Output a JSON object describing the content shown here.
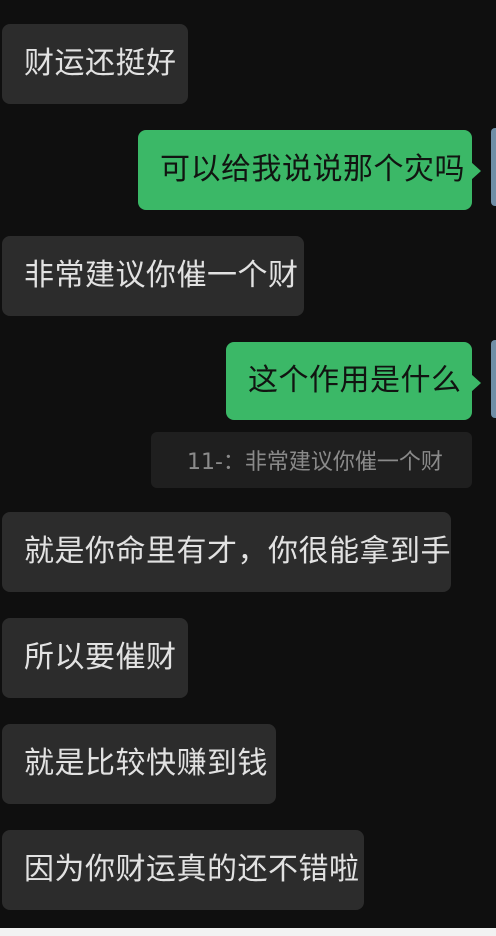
{
  "messages": [
    {
      "side": "in",
      "text": "财运还挺好"
    },
    {
      "side": "out",
      "text": "可以给我说说那个灾吗"
    },
    {
      "side": "in",
      "text": "非常建议你催一个财"
    },
    {
      "side": "out",
      "text": "这个作用是什么"
    },
    {
      "side": "in",
      "text": "就是你命里有才，你很能拿到手"
    },
    {
      "side": "in",
      "text": "所以要催财"
    },
    {
      "side": "in",
      "text": "就是比较快赚到钱"
    },
    {
      "side": "in",
      "text": "因为你财运真的还不错啦"
    }
  ],
  "quote": {
    "text": "11-：非常建议你催一个财"
  }
}
